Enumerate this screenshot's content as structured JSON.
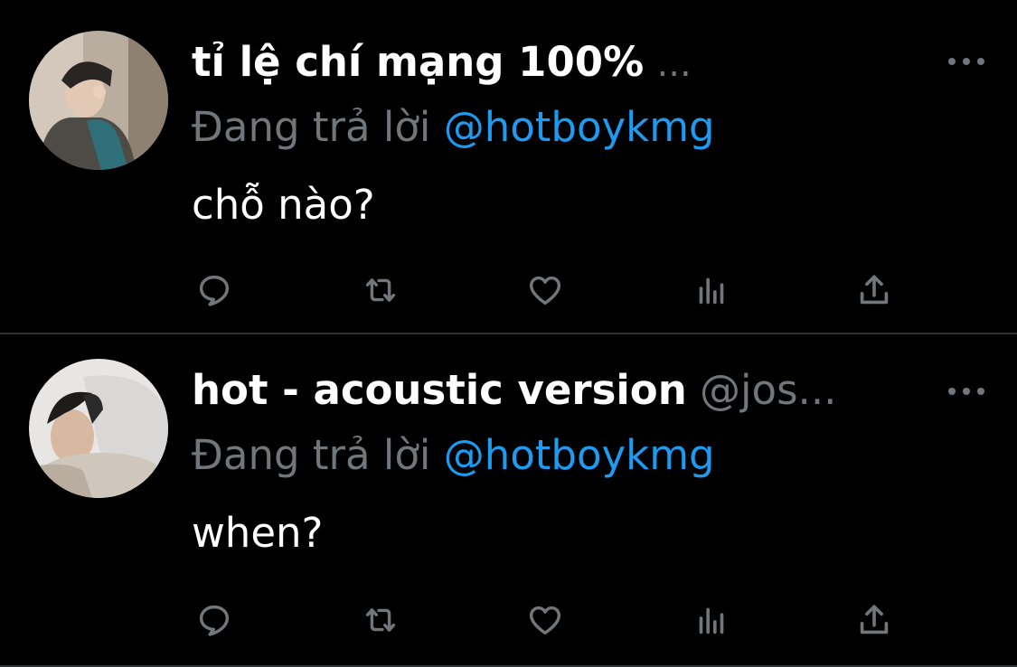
{
  "tweets": [
    {
      "display_name": "tỉ lệ chí mạng 100%",
      "truncation": "...",
      "handle": "",
      "reply_prefix": "Đang trả lời",
      "reply_to": "@hotboykmg",
      "text": "chỗ nào?",
      "avatar": "profile-photo-person-waving",
      "actions": [
        "reply-icon",
        "retweet-icon",
        "like-icon",
        "views-icon",
        "share-icon"
      ]
    },
    {
      "display_name": "hot - acoustic version",
      "truncation": "",
      "handle": "@jos...",
      "reply_prefix": "Đang trả lời",
      "reply_to": "@hotboykmg",
      "text": "when?",
      "avatar": "profile-photo-person-lying-on-pillow",
      "actions": [
        "reply-icon",
        "retweet-icon",
        "like-icon",
        "views-icon",
        "share-icon"
      ]
    }
  ],
  "colors": {
    "background": "#000000",
    "primary_text": "#ffffff",
    "secondary_text": "#71767b",
    "accent": "#1d9bf0",
    "divider": "#2f3336"
  }
}
